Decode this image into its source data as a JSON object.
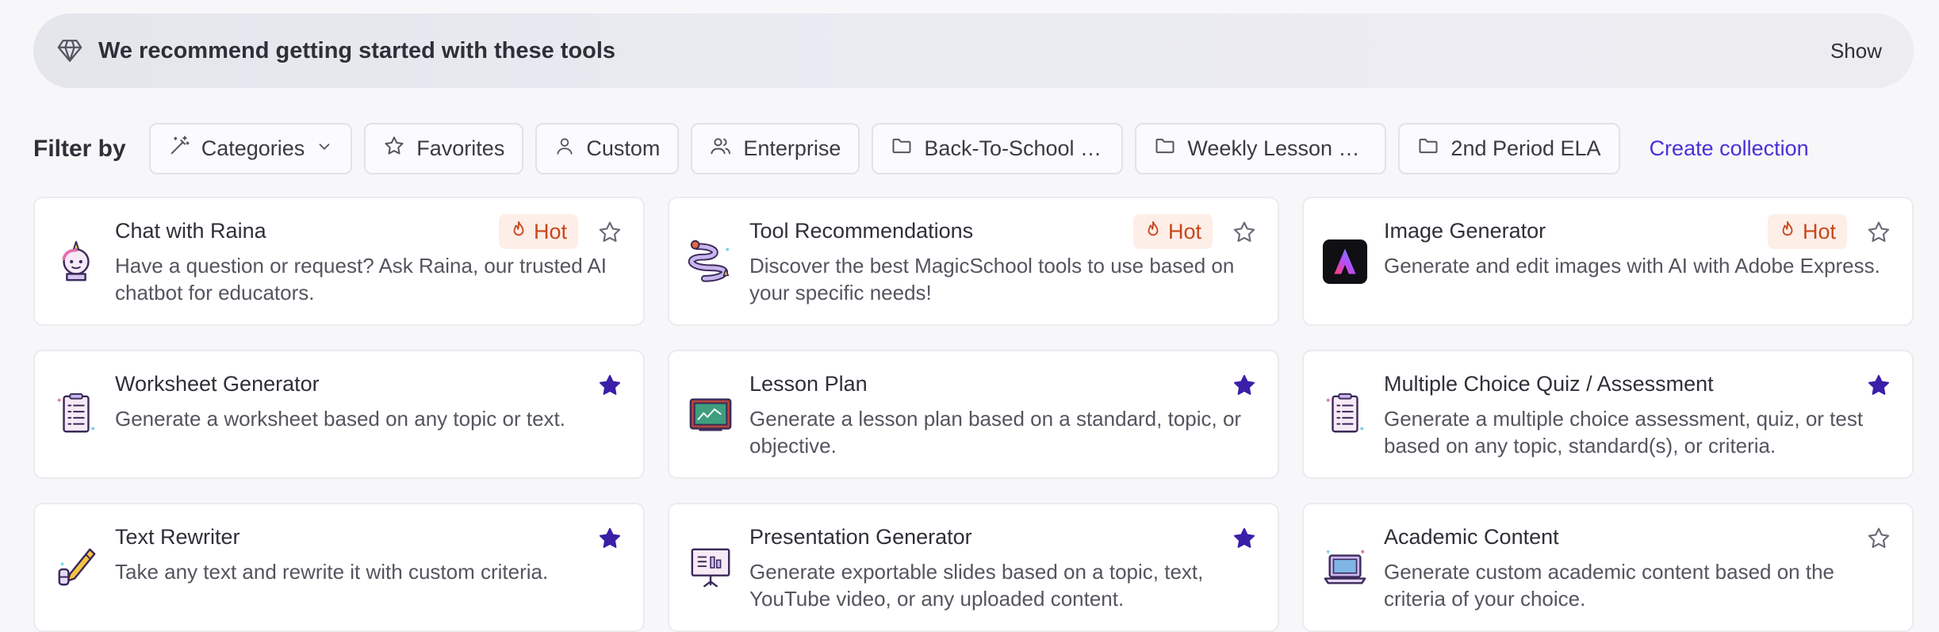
{
  "banner": {
    "text": "We recommend getting started with these tools",
    "action": "Show"
  },
  "filter": {
    "label": "Filter by",
    "chips": {
      "categories": "Categories",
      "favorites": "Favorites",
      "custom": "Custom",
      "enterprise": "Enterprise",
      "back_to_school": "Back-To-School Week",
      "weekly_lesson": "Weekly Lesson Planning",
      "second_period": "2nd Period ELA"
    },
    "create_collection": "Create collection"
  },
  "hot_label": "Hot",
  "cards": [
    {
      "title": "Chat with Raina",
      "desc": "Have a question or request? Ask Raina, our trusted AI chatbot for educators.",
      "hot": true,
      "favorite": false
    },
    {
      "title": "Tool Recommendations",
      "desc": "Discover the best MagicSchool tools to use based on your specific needs!",
      "hot": true,
      "favorite": false
    },
    {
      "title": "Image Generator",
      "desc": "Generate and edit images with AI with Adobe Express.",
      "hot": true,
      "favorite": false
    },
    {
      "title": "Worksheet Generator",
      "desc": "Generate a worksheet based on any topic or text.",
      "hot": false,
      "favorite": true
    },
    {
      "title": "Lesson Plan",
      "desc": "Generate a lesson plan based on a standard, topic, or objective.",
      "hot": false,
      "favorite": true
    },
    {
      "title": "Multiple Choice Quiz / Assessment",
      "desc": "Generate a multiple choice assessment, quiz, or test based on any topic, standard(s), or criteria.",
      "hot": false,
      "favorite": true
    },
    {
      "title": "Text Rewriter",
      "desc": "Take any text and rewrite it with custom criteria.",
      "hot": false,
      "favorite": true
    },
    {
      "title": "Presentation Generator",
      "desc": "Generate exportable slides based on a topic, text, YouTube video, or any uploaded content.",
      "hot": false,
      "favorite": true
    },
    {
      "title": "Academic Content",
      "desc": "Generate custom academic content based on the criteria of your choice.",
      "hot": false,
      "favorite": false
    }
  ],
  "colors": {
    "accent": "#4b2fd6",
    "star_filled": "#3a1fa8",
    "hot_text": "#c8471b",
    "hot_bg": "#fdeee8"
  }
}
